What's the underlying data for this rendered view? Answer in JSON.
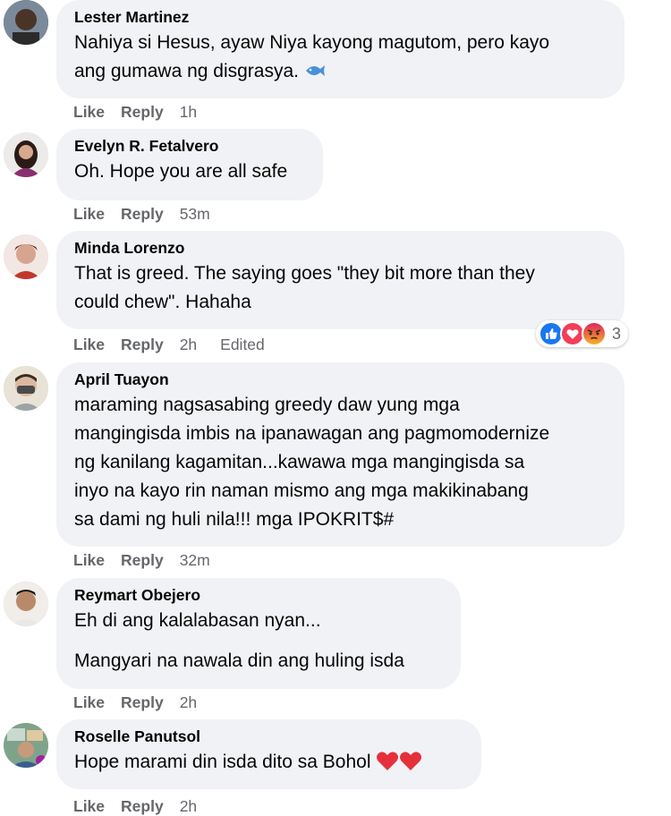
{
  "comments": [
    {
      "name": "Lester Martinez",
      "text": [
        "Nahiya si Hesus, ayaw Niya kayong magutom, pero kayo",
        "ang gumawa ng disgrasya."
      ],
      "emoji": "fish-icon",
      "like": "Like",
      "reply": "Reply",
      "time": "1h"
    },
    {
      "name": "Evelyn R. Fetalvero",
      "text": [
        "Oh. Hope you are all safe"
      ],
      "like": "Like",
      "reply": "Reply",
      "time": "53m"
    },
    {
      "name": "Minda Lorenzo",
      "text": [
        "That is greed. The saying goes \"they bit more than they",
        "could chew\". Hahaha"
      ],
      "like": "Like",
      "reply": "Reply",
      "time": "2h",
      "edited": "Edited",
      "reactions": {
        "icons": [
          "like-reaction-icon",
          "love-reaction-icon",
          "angry-reaction-icon"
        ],
        "count": "3"
      }
    },
    {
      "name": "April Tuayon",
      "text": [
        "maraming nagsasabing greedy daw yung mga",
        "mangingisda imbis na ipanawagan ang pagmomodernize",
        "ng kanilang kagamitan...kawawa mga mangingisda sa",
        "inyo na kayo rin naman mismo ang mga makikinabang",
        "sa dami ng huli nila!!! mga IPOKRIT$#"
      ],
      "like": "Like",
      "reply": "Reply",
      "time": "32m"
    },
    {
      "name": "Reymart Obejero",
      "paragraphs": [
        "Eh di ang kalalabasan nyan...",
        "Mangyari na nawala din ang huling isda"
      ],
      "like": "Like",
      "reply": "Reply",
      "time": "2h"
    },
    {
      "name": "Roselle Panutsol",
      "text": [
        "Hope marami din isda dito sa Bohol"
      ],
      "emoji": "heart-icon",
      "like": "Like",
      "reply": "Reply",
      "time": "2h"
    }
  ],
  "colors": {
    "bubble": "#f0f2f5",
    "meta": "#65676b",
    "text": "#050505",
    "like": "#1877f2",
    "love": "#f33e58",
    "angry": "#e9710f"
  }
}
